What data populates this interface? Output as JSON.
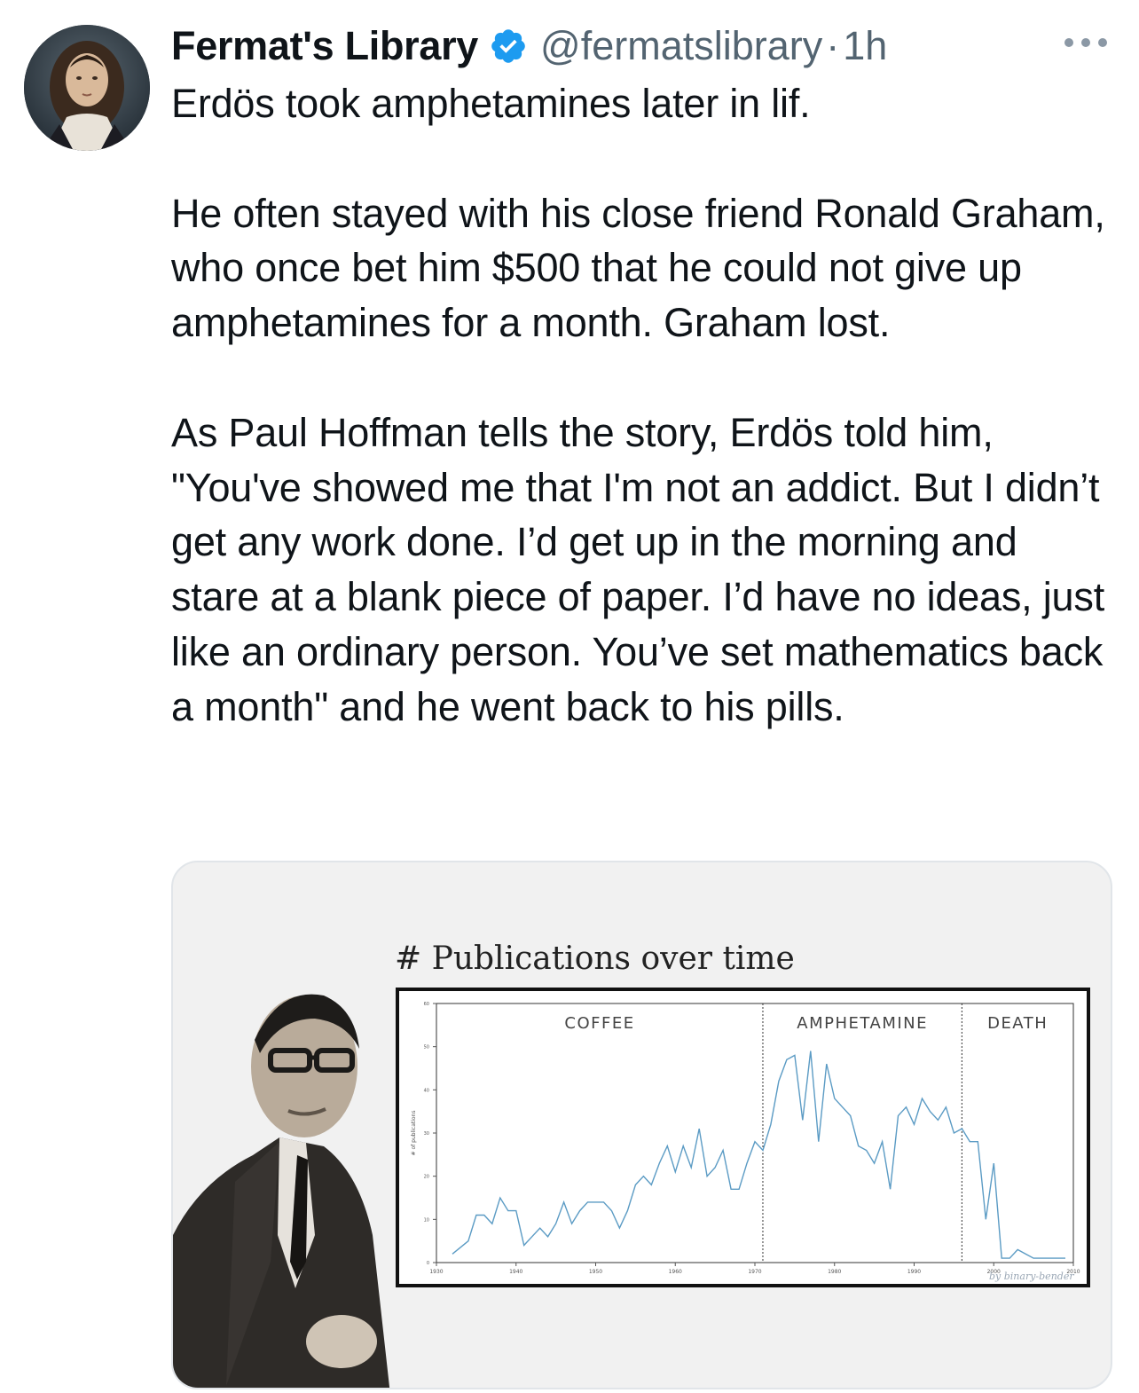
{
  "tweet": {
    "author_name": "Fermat's Library",
    "handle": "@fermatslibrary",
    "separator": "·",
    "time": "1h",
    "text": "Erdös took amphetamines later in lif.\n\nHe often stayed with his close friend Ronald Graham, who once bet him $500 that he could not give up amphetamines for a month. Graham lost.\n\nAs Paul Hoffman tells the story, Erdös told him, \"You've showed me that I'm not an addict. But I didn’t get any work done. I’d get up in the morning and stare at a blank piece of paper. I’d have no ideas, just like an ordinary person. You’ve set mathematics back a month\" and he went back to his pills."
  },
  "icons": {
    "avatar": "portrait-avatar",
    "verified": "verified-badge-icon",
    "more": "more-options-icon"
  },
  "colors": {
    "verified_blue": "#1d9bf0",
    "secondary_text": "#536471",
    "chart_line": "#5b9bc4"
  },
  "media": {
    "title": "# Publications over time",
    "credit": "by binary-bender"
  },
  "chart_data": {
    "type": "line",
    "title": "# Publications over time",
    "ylabel": "# of publications",
    "xlabel": "",
    "xlim": [
      1930,
      2010
    ],
    "ylim": [
      0,
      60
    ],
    "x_ticks": [
      1930,
      1940,
      1950,
      1960,
      1970,
      1980,
      1990,
      2000,
      2010
    ],
    "y_ticks": [
      0,
      10,
      20,
      30,
      40,
      50,
      60
    ],
    "grid": false,
    "regions": [
      {
        "label": "COFFEE",
        "start": 1930,
        "end": 1971
      },
      {
        "label": "AMPHETAMINE",
        "start": 1971,
        "end": 1996
      },
      {
        "label": "DEATH",
        "start": 1996,
        "end": 2010
      }
    ],
    "series": [
      {
        "x": [
          1932,
          1934,
          1935,
          1936,
          1937,
          1938,
          1939,
          1940,
          1941,
          1942,
          1943,
          1944,
          1945,
          1946,
          1947,
          1948,
          1949,
          1950,
          1951,
          1952,
          1953,
          1954,
          1955,
          1956,
          1957,
          1958,
          1959,
          1960,
          1961,
          1962,
          1963,
          1964,
          1965,
          1966,
          1967,
          1968,
          1969,
          1970,
          1971,
          1972,
          1973,
          1974,
          1975,
          1976,
          1977,
          1978,
          1979,
          1980,
          1981,
          1982,
          1983,
          1984,
          1985,
          1986,
          1987,
          1988,
          1989,
          1990,
          1991,
          1992,
          1993,
          1994,
          1995,
          1996,
          1997,
          1998,
          1999,
          2000,
          2001,
          2002,
          2003,
          2004,
          2005,
          2006,
          2007,
          2008,
          2009
        ],
        "values": [
          2,
          5,
          11,
          11,
          9,
          15,
          12,
          12,
          4,
          6,
          8,
          6,
          9,
          14,
          9,
          12,
          14,
          14,
          14,
          12,
          8,
          12,
          18,
          20,
          18,
          23,
          27,
          21,
          27,
          22,
          31,
          20,
          22,
          26,
          17,
          17,
          23,
          28,
          26,
          32,
          42,
          47,
          48,
          33,
          49,
          28,
          46,
          38,
          36,
          34,
          27,
          26,
          23,
          28,
          17,
          34,
          36,
          32,
          38,
          35,
          33,
          36,
          30,
          31,
          28,
          28,
          10,
          23,
          1,
          1,
          3,
          2,
          1,
          1,
          1,
          1,
          1
        ]
      }
    ]
  }
}
